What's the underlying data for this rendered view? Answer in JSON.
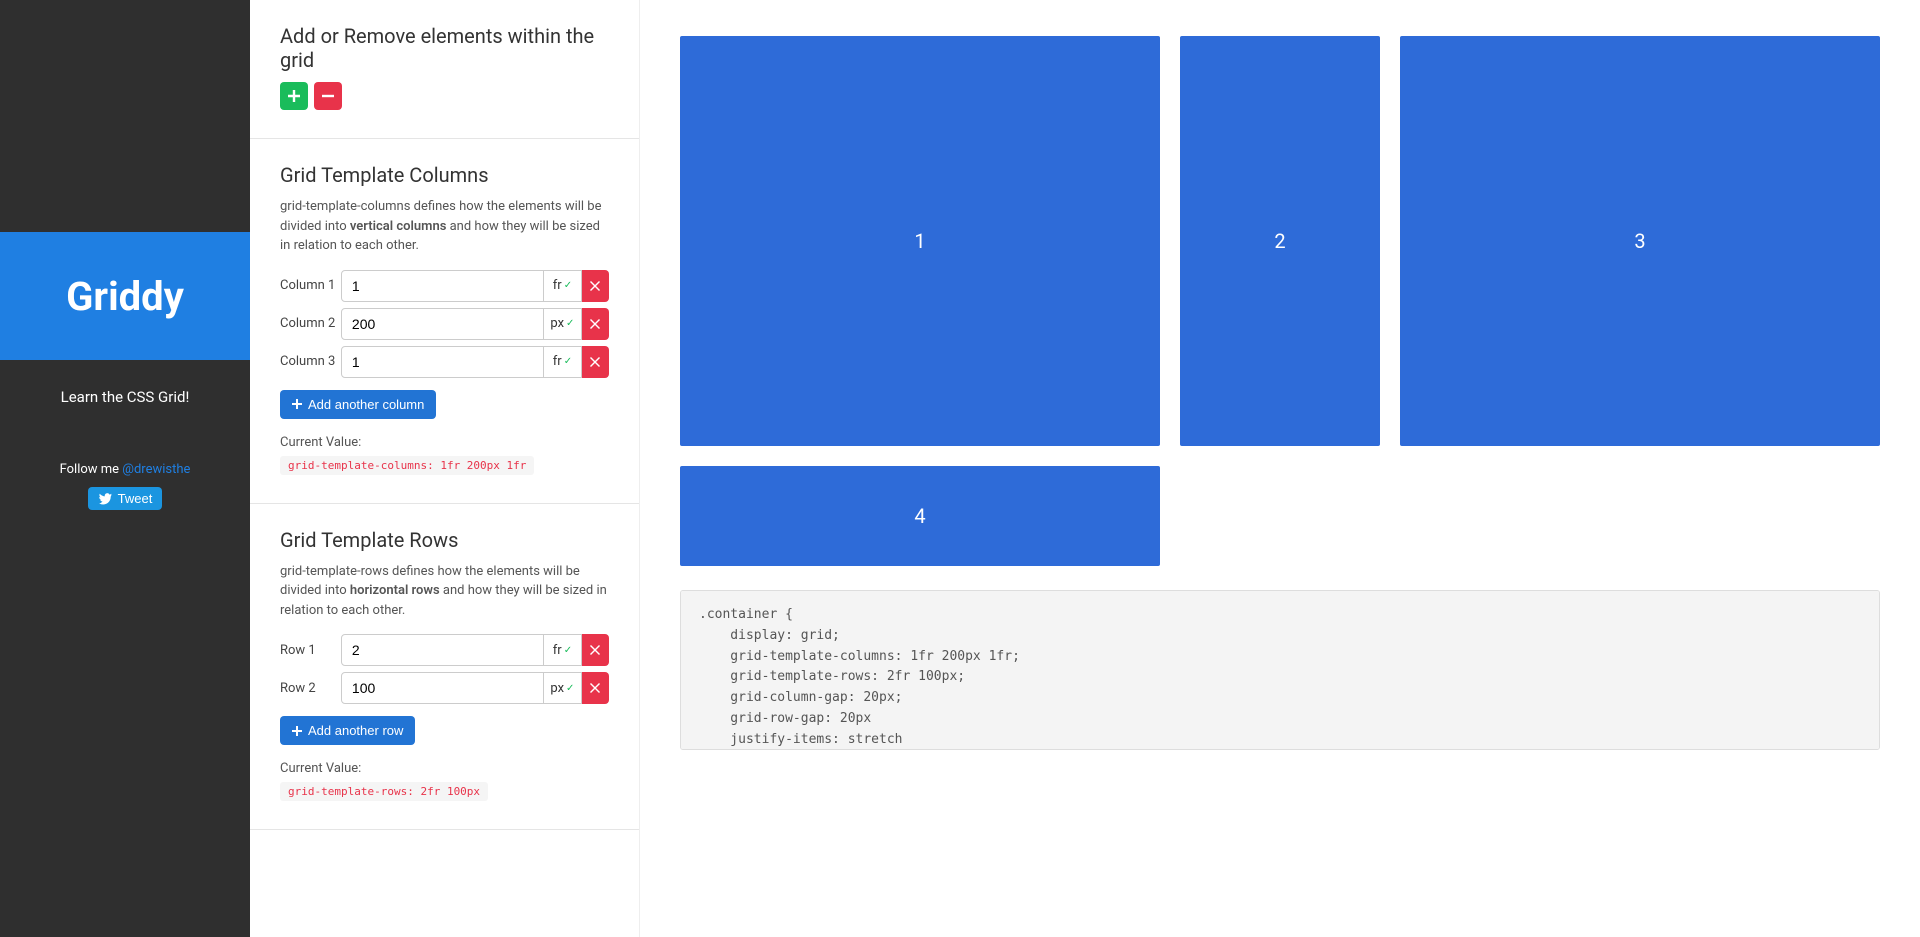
{
  "sidebar": {
    "brand": "Griddy",
    "tagline": "Learn the CSS Grid!",
    "follow_prefix": "Follow me ",
    "follow_handle": "@drewisthe",
    "tweet_label": "Tweet"
  },
  "add_remove": {
    "heading": "Add or Remove elements within the grid"
  },
  "columns_section": {
    "heading": "Grid Template Columns",
    "desc_pre": "grid-template-columns defines how the elements will be divided into ",
    "desc_strong": "vertical columns",
    "desc_post": " and how they will be sized in relation to each other.",
    "rows": [
      {
        "label": "Column 1",
        "value": "1",
        "unit": "fr"
      },
      {
        "label": "Column 2",
        "value": "200",
        "unit": "px"
      },
      {
        "label": "Column 3",
        "value": "1",
        "unit": "fr"
      }
    ],
    "add_label": "Add another column",
    "current_label": "Current Value:",
    "current_code": "grid-template-columns: 1fr 200px 1fr"
  },
  "rows_section": {
    "heading": "Grid Template Rows",
    "desc_pre": "grid-template-rows defines how the elements will be divided into ",
    "desc_strong": "horizontal rows",
    "desc_post": " and how they will be sized in relation to each other.",
    "rows": [
      {
        "label": "Row 1",
        "value": "2",
        "unit": "fr"
      },
      {
        "label": "Row 2",
        "value": "100",
        "unit": "px"
      }
    ],
    "add_label": "Add another row",
    "current_label": "Current Value:",
    "current_code": "grid-template-rows: 2fr 100px"
  },
  "preview": {
    "cells": [
      "1",
      "2",
      "3",
      "4"
    ],
    "code": ".container {\n    display: grid;\n    grid-template-columns: 1fr 200px 1fr;\n    grid-template-rows: 2fr 100px;\n    grid-column-gap: 20px;\n    grid-row-gap: 20px\n    justify-items: stretch\n    align-items: stretch\n}"
  }
}
